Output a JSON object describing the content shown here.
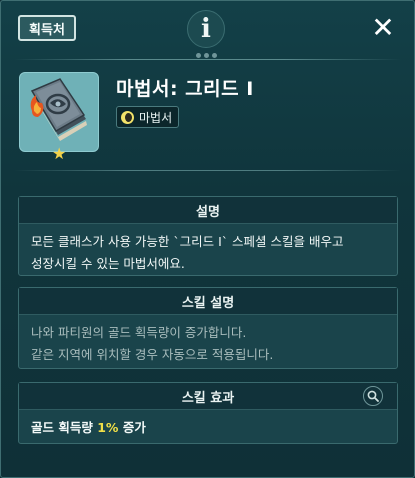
{
  "header": {
    "source_tab": "획득처",
    "info_glyph": "i",
    "close_glyph": "✕"
  },
  "item": {
    "name": "마법서: 그리드 I",
    "type_tag": "마법서",
    "icon": "spellbook-icon",
    "badge_icon": "star-icon"
  },
  "description": {
    "title": "설명",
    "lines": [
      "모든 클래스가 사용 가능한 `그리드 I` 스페셜 스킬을 배우고",
      "성장시킬 수 있는 마법서에요."
    ]
  },
  "skill_description": {
    "title": "스킬 설명",
    "lines": [
      "나와 파티원의 골드 획득량이 증가합니다.",
      "같은 지역에 위치할 경우 자동으로 적용됩니다."
    ]
  },
  "skill_effect": {
    "title": "스킬 효과",
    "label": "골드 획득량",
    "value": "1%",
    "suffix": "증가",
    "search_icon": "magnifier-icon"
  },
  "colors": {
    "background": "#0f2f36",
    "panel": "#1a444b",
    "highlight": "#f0df48",
    "item_slot": "#6fb1b7"
  }
}
